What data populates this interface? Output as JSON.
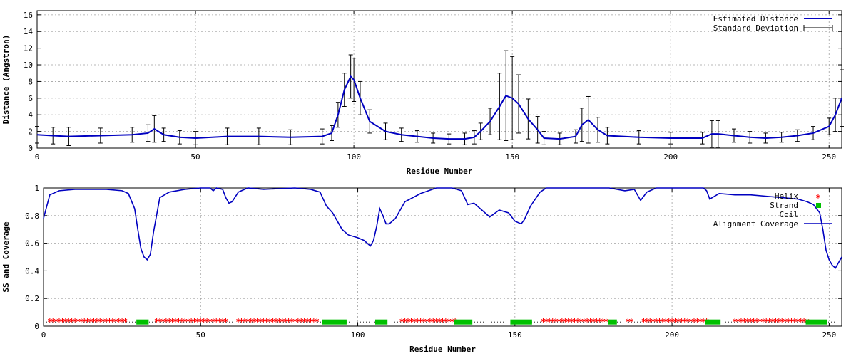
{
  "chart_data": [
    {
      "type": "line",
      "xlabel": "Residue Number",
      "ylabel": "Distance (Angstron)",
      "xlim": [
        0,
        254
      ],
      "ylim": [
        0,
        16.5
      ],
      "xticks": [
        0,
        50,
        100,
        150,
        200,
        250
      ],
      "yticks": [
        0,
        2,
        4,
        6,
        8,
        10,
        12,
        14,
        16
      ],
      "grid": true,
      "legend": "top-right",
      "colors": {
        "line": "#0000c0",
        "errorbar": "#000000"
      },
      "series": [
        {
          "name": "Estimated Distance",
          "x": [
            0,
            5,
            10,
            20,
            30,
            35,
            37,
            40,
            45,
            50,
            60,
            70,
            80,
            90,
            93,
            95,
            97,
            99,
            100,
            102,
            105,
            110,
            115,
            120,
            125,
            130,
            135,
            138,
            140,
            143,
            146,
            148,
            150,
            152,
            155,
            158,
            160,
            165,
            170,
            172,
            174,
            177,
            180,
            190,
            200,
            210,
            213,
            215,
            220,
            225,
            230,
            235,
            240,
            245,
            250,
            252,
            254
          ],
          "y": [
            1.6,
            1.5,
            1.4,
            1.5,
            1.6,
            1.8,
            2.3,
            1.6,
            1.3,
            1.2,
            1.4,
            1.4,
            1.3,
            1.4,
            1.8,
            4.0,
            7.0,
            8.6,
            8.2,
            6.0,
            3.2,
            2.0,
            1.6,
            1.4,
            1.2,
            1.1,
            1.1,
            1.3,
            2.0,
            3.2,
            5.0,
            6.3,
            6.0,
            5.3,
            3.5,
            2.2,
            1.2,
            1.1,
            1.4,
            2.8,
            3.4,
            2.2,
            1.5,
            1.3,
            1.2,
            1.2,
            1.7,
            1.7,
            1.5,
            1.3,
            1.2,
            1.3,
            1.5,
            1.8,
            2.6,
            4.0,
            6.0
          ]
        },
        {
          "name": "Standard Deviation",
          "x": [
            0,
            5,
            10,
            20,
            30,
            35,
            37,
            40,
            45,
            50,
            60,
            70,
            80,
            90,
            93,
            95,
            97,
            99,
            100,
            102,
            105,
            110,
            115,
            120,
            125,
            130,
            135,
            138,
            140,
            143,
            146,
            148,
            150,
            152,
            155,
            158,
            160,
            165,
            170,
            172,
            174,
            177,
            180,
            190,
            200,
            210,
            213,
            215,
            220,
            225,
            230,
            235,
            240,
            245,
            250,
            252,
            254
          ],
          "err": [
            1.0,
            1.0,
            1.1,
            0.9,
            0.9,
            1.0,
            1.6,
            0.8,
            0.8,
            0.8,
            1.0,
            1.0,
            0.9,
            0.9,
            0.9,
            1.5,
            2.0,
            2.6,
            2.6,
            2.0,
            1.4,
            1.0,
            0.8,
            0.7,
            0.6,
            0.6,
            0.7,
            0.8,
            1.0,
            1.6,
            4.0,
            5.4,
            5.0,
            3.5,
            2.4,
            1.6,
            0.8,
            0.7,
            0.8,
            2.0,
            2.8,
            1.5,
            1.0,
            0.8,
            0.7,
            0.7,
            1.6,
            1.6,
            0.8,
            0.7,
            0.6,
            0.6,
            0.7,
            0.8,
            1.0,
            2.0,
            3.4
          ]
        }
      ]
    },
    {
      "type": "line",
      "xlabel": "Residue Number",
      "ylabel": "SS and Coverage",
      "xlim": [
        0,
        254
      ],
      "ylim": [
        0,
        1
      ],
      "xticks": [
        0,
        50,
        100,
        150,
        200,
        250
      ],
      "yticks": [
        0,
        0.2,
        0.4,
        0.6,
        0.8,
        1
      ],
      "grid": true,
      "legend": "top-right",
      "colors": {
        "Helix": "#ff0000",
        "Strand": "#00c000",
        "Coil": "#000000",
        "Alignment Coverage": "#0000c0"
      },
      "series": [
        {
          "name": "Helix",
          "marker": "*",
          "y": 0.03,
          "ranges": [
            [
              2,
              26
            ],
            [
              36,
              58
            ],
            [
              62,
              87
            ],
            [
              114,
              131
            ],
            [
              159,
              179
            ],
            [
              186,
              187
            ],
            [
              191,
              211
            ],
            [
              220,
              243
            ]
          ]
        },
        {
          "name": "Strand",
          "marker": "square",
          "y": 0.03,
          "ranges": [
            [
              30,
              33
            ],
            [
              89,
              96
            ],
            [
              106,
              109
            ],
            [
              131,
              136
            ],
            [
              149,
              155
            ],
            [
              180,
              182
            ],
            [
              211,
              215
            ],
            [
              243,
              249
            ]
          ]
        },
        {
          "name": "Coil",
          "marker": "none",
          "y": 0.03,
          "ranges": []
        },
        {
          "name": "Alignment Coverage",
          "x": [
            0,
            2,
            5,
            10,
            20,
            25,
            27,
            29,
            30,
            31,
            32,
            33,
            34,
            35,
            37,
            40,
            45,
            50,
            53,
            54,
            55,
            57,
            58,
            59,
            60,
            62,
            65,
            70,
            80,
            85,
            88,
            90,
            92,
            94,
            95,
            97,
            100,
            102,
            104,
            105,
            106,
            107,
            108,
            109,
            110,
            112,
            115,
            120,
            125,
            130,
            133,
            135,
            137,
            140,
            142,
            145,
            148,
            150,
            152,
            153,
            155,
            158,
            160,
            170,
            180,
            185,
            188,
            190,
            192,
            195,
            200,
            210,
            211,
            212,
            215,
            220,
            225,
            230,
            235,
            240,
            243,
            245,
            247,
            248,
            249,
            250,
            251,
            252,
            254
          ],
          "y": [
            0.78,
            0.95,
            0.98,
            0.99,
            0.99,
            0.98,
            0.96,
            0.85,
            0.7,
            0.56,
            0.5,
            0.48,
            0.52,
            0.68,
            0.93,
            0.97,
            0.99,
            1.0,
            1.0,
            0.98,
            1.0,
            0.99,
            0.93,
            0.89,
            0.9,
            0.97,
            1.0,
            0.99,
            1.0,
            0.99,
            0.97,
            0.87,
            0.82,
            0.74,
            0.7,
            0.66,
            0.64,
            0.62,
            0.58,
            0.62,
            0.72,
            0.85,
            0.8,
            0.74,
            0.74,
            0.78,
            0.9,
            0.96,
            1.0,
            1.0,
            0.98,
            0.88,
            0.89,
            0.83,
            0.79,
            0.84,
            0.82,
            0.76,
            0.74,
            0.77,
            0.87,
            0.97,
            1.0,
            1.0,
            1.0,
            0.98,
            0.99,
            0.91,
            0.97,
            1.0,
            1.0,
            1.0,
            0.98,
            0.92,
            0.96,
            0.95,
            0.95,
            0.94,
            0.93,
            0.92,
            0.9,
            0.88,
            0.82,
            0.7,
            0.55,
            0.48,
            0.44,
            0.42,
            0.5
          ]
        }
      ]
    }
  ]
}
